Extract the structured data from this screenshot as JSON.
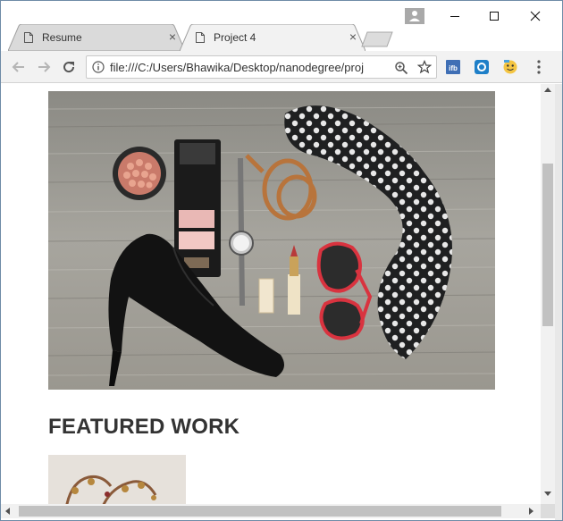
{
  "browser": {
    "tabs": [
      {
        "title": "Resume",
        "active": false
      },
      {
        "title": "Project 4",
        "active": true
      }
    ],
    "tab_close_glyph": "×",
    "address_bar": {
      "url": "file:///C:/Users/Bhawika/Desktop/nanodegree/proj"
    },
    "extensions": [
      "ifb-extension-icon",
      "blue-circle-extension-icon",
      "smiley-extension-icon"
    ]
  },
  "page": {
    "hero_alt": "flat lay of accessories: high heel, makeup, watch, belt, sunglasses, polka dot scarf",
    "featured_heading": "FEATURED WORK"
  },
  "colors": {
    "accent_scroll": "#c1c1c1",
    "heading": "#333333",
    "window_border": "#6e8ba7"
  }
}
